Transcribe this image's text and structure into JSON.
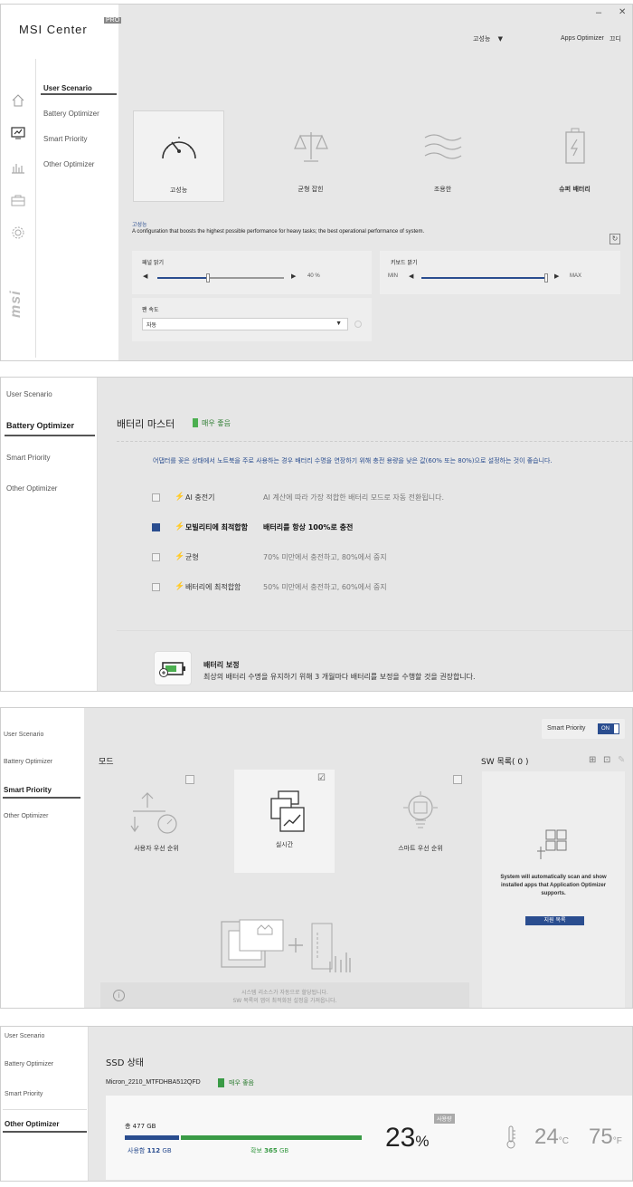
{
  "p1": {
    "logo": "MSI Center",
    "logo_badge": "PRO",
    "window_controls": {
      "minimize": "–",
      "close": "✕"
    },
    "header_mode": "고성능",
    "header_apps": "Apps Optimizer",
    "header_extra": "끄디",
    "sidebar": [
      "User Scenario",
      "Battery Optimizer",
      "Smart Priority",
      "Other Optimizer"
    ],
    "side_brand": "msi",
    "modes": [
      "고성능",
      "균형 잡힌",
      "조용한",
      "슈퍼 배터리"
    ],
    "mode_title": "고성능",
    "mode_desc": "A configuration that boosts the highest possible performance for heavy tasks; the best operational performance of system.",
    "panel_brightness": {
      "label": "패널 밝기",
      "value": "40 %",
      "level": 0.4
    },
    "keyboard_brightness": {
      "label": "키보드 밝기",
      "min": "MIN",
      "max": "MAX",
      "level": 1.0
    },
    "fan": {
      "label": "팬 속도",
      "value": "자동"
    }
  },
  "p2": {
    "sidebar": [
      "User Scenario",
      "Battery Optimizer",
      "Smart Priority",
      "Other Optimizer"
    ],
    "title": "배터리 마스터",
    "health": "매우 좋음",
    "notice": "어댑터를 꽂은 상태에서 노트북을 주로 사용하는 경우 배터리 수명을 연장하기 위해 충전 용량을 낮은 값(60% 또는 80%)으로 설정하는 것이 좋습니다.",
    "options": [
      {
        "name": "AI 충전기",
        "desc": "AI 계산에 따라 가장 적합한 배터리 모드로 자동 전환됩니다.",
        "checked": false,
        "bolt": "#d9472b"
      },
      {
        "name": "모빌리티에 최적합함",
        "desc": "배터리를 항상 100%로 충전",
        "checked": true,
        "bolt": "#e8a21a"
      },
      {
        "name": "균형",
        "desc": "70% 미만에서 충전하고, 80%에서 중지",
        "checked": false,
        "bolt": "#2f86d6"
      },
      {
        "name": "배터리에 최적합함",
        "desc": "50% 미만에서 충전하고, 60%에서 중지",
        "checked": false,
        "bolt": "#4caf50"
      }
    ],
    "calib_title": "배터리 보정",
    "calib_desc": "최상의 배터리 수명을 유지하기 위해 3 개월마다 배터리를 보정을 수행할 것을 권장합니다."
  },
  "p3": {
    "sidebar": [
      "User Scenario",
      "Battery Optimizer",
      "Smart Priority",
      "Other Optimizer"
    ],
    "smart_priority_label": "Smart Priority",
    "toggle": "ON",
    "mode_label": "모드",
    "modes": [
      "사용자 우선 순위",
      "실시간",
      "스마트 우선 순위"
    ],
    "sw_list": "SW 목록( 0 )",
    "sw_info": "System will automatically scan and show installed apps that Application Optimizer supports.",
    "support_btn": "지원 목록",
    "footer_line1": "시스템 리소스가 자동으로 할당됩니다.",
    "footer_line2": "SW 목록의 앱이 최적화된 설정을 가져옵니다."
  },
  "p4": {
    "sidebar": [
      "User Scenario",
      "Battery Optimizer",
      "Smart Priority",
      "Other Optimizer"
    ],
    "title": "SSD 상태",
    "drive": "Micron_2210_MTFDHBA512QFD",
    "health": "매우 좋음",
    "total": "총 477 GB",
    "used_label": "사용함",
    "used_value": "112",
    "used_unit": "GB",
    "free_label": "확보",
    "free_value": "365",
    "free_unit": "GB",
    "used_ratio": 0.23,
    "usage_percent": "23",
    "percent_sign": "%",
    "usage_badge": "사용량",
    "temp_c": "24",
    "unit_c": "°C",
    "temp_f": "75",
    "unit_f": "°F"
  },
  "colors": {
    "accent": "#2a4d8f",
    "green": "#4caf50",
    "sidebar_bg": "#ffffff"
  }
}
